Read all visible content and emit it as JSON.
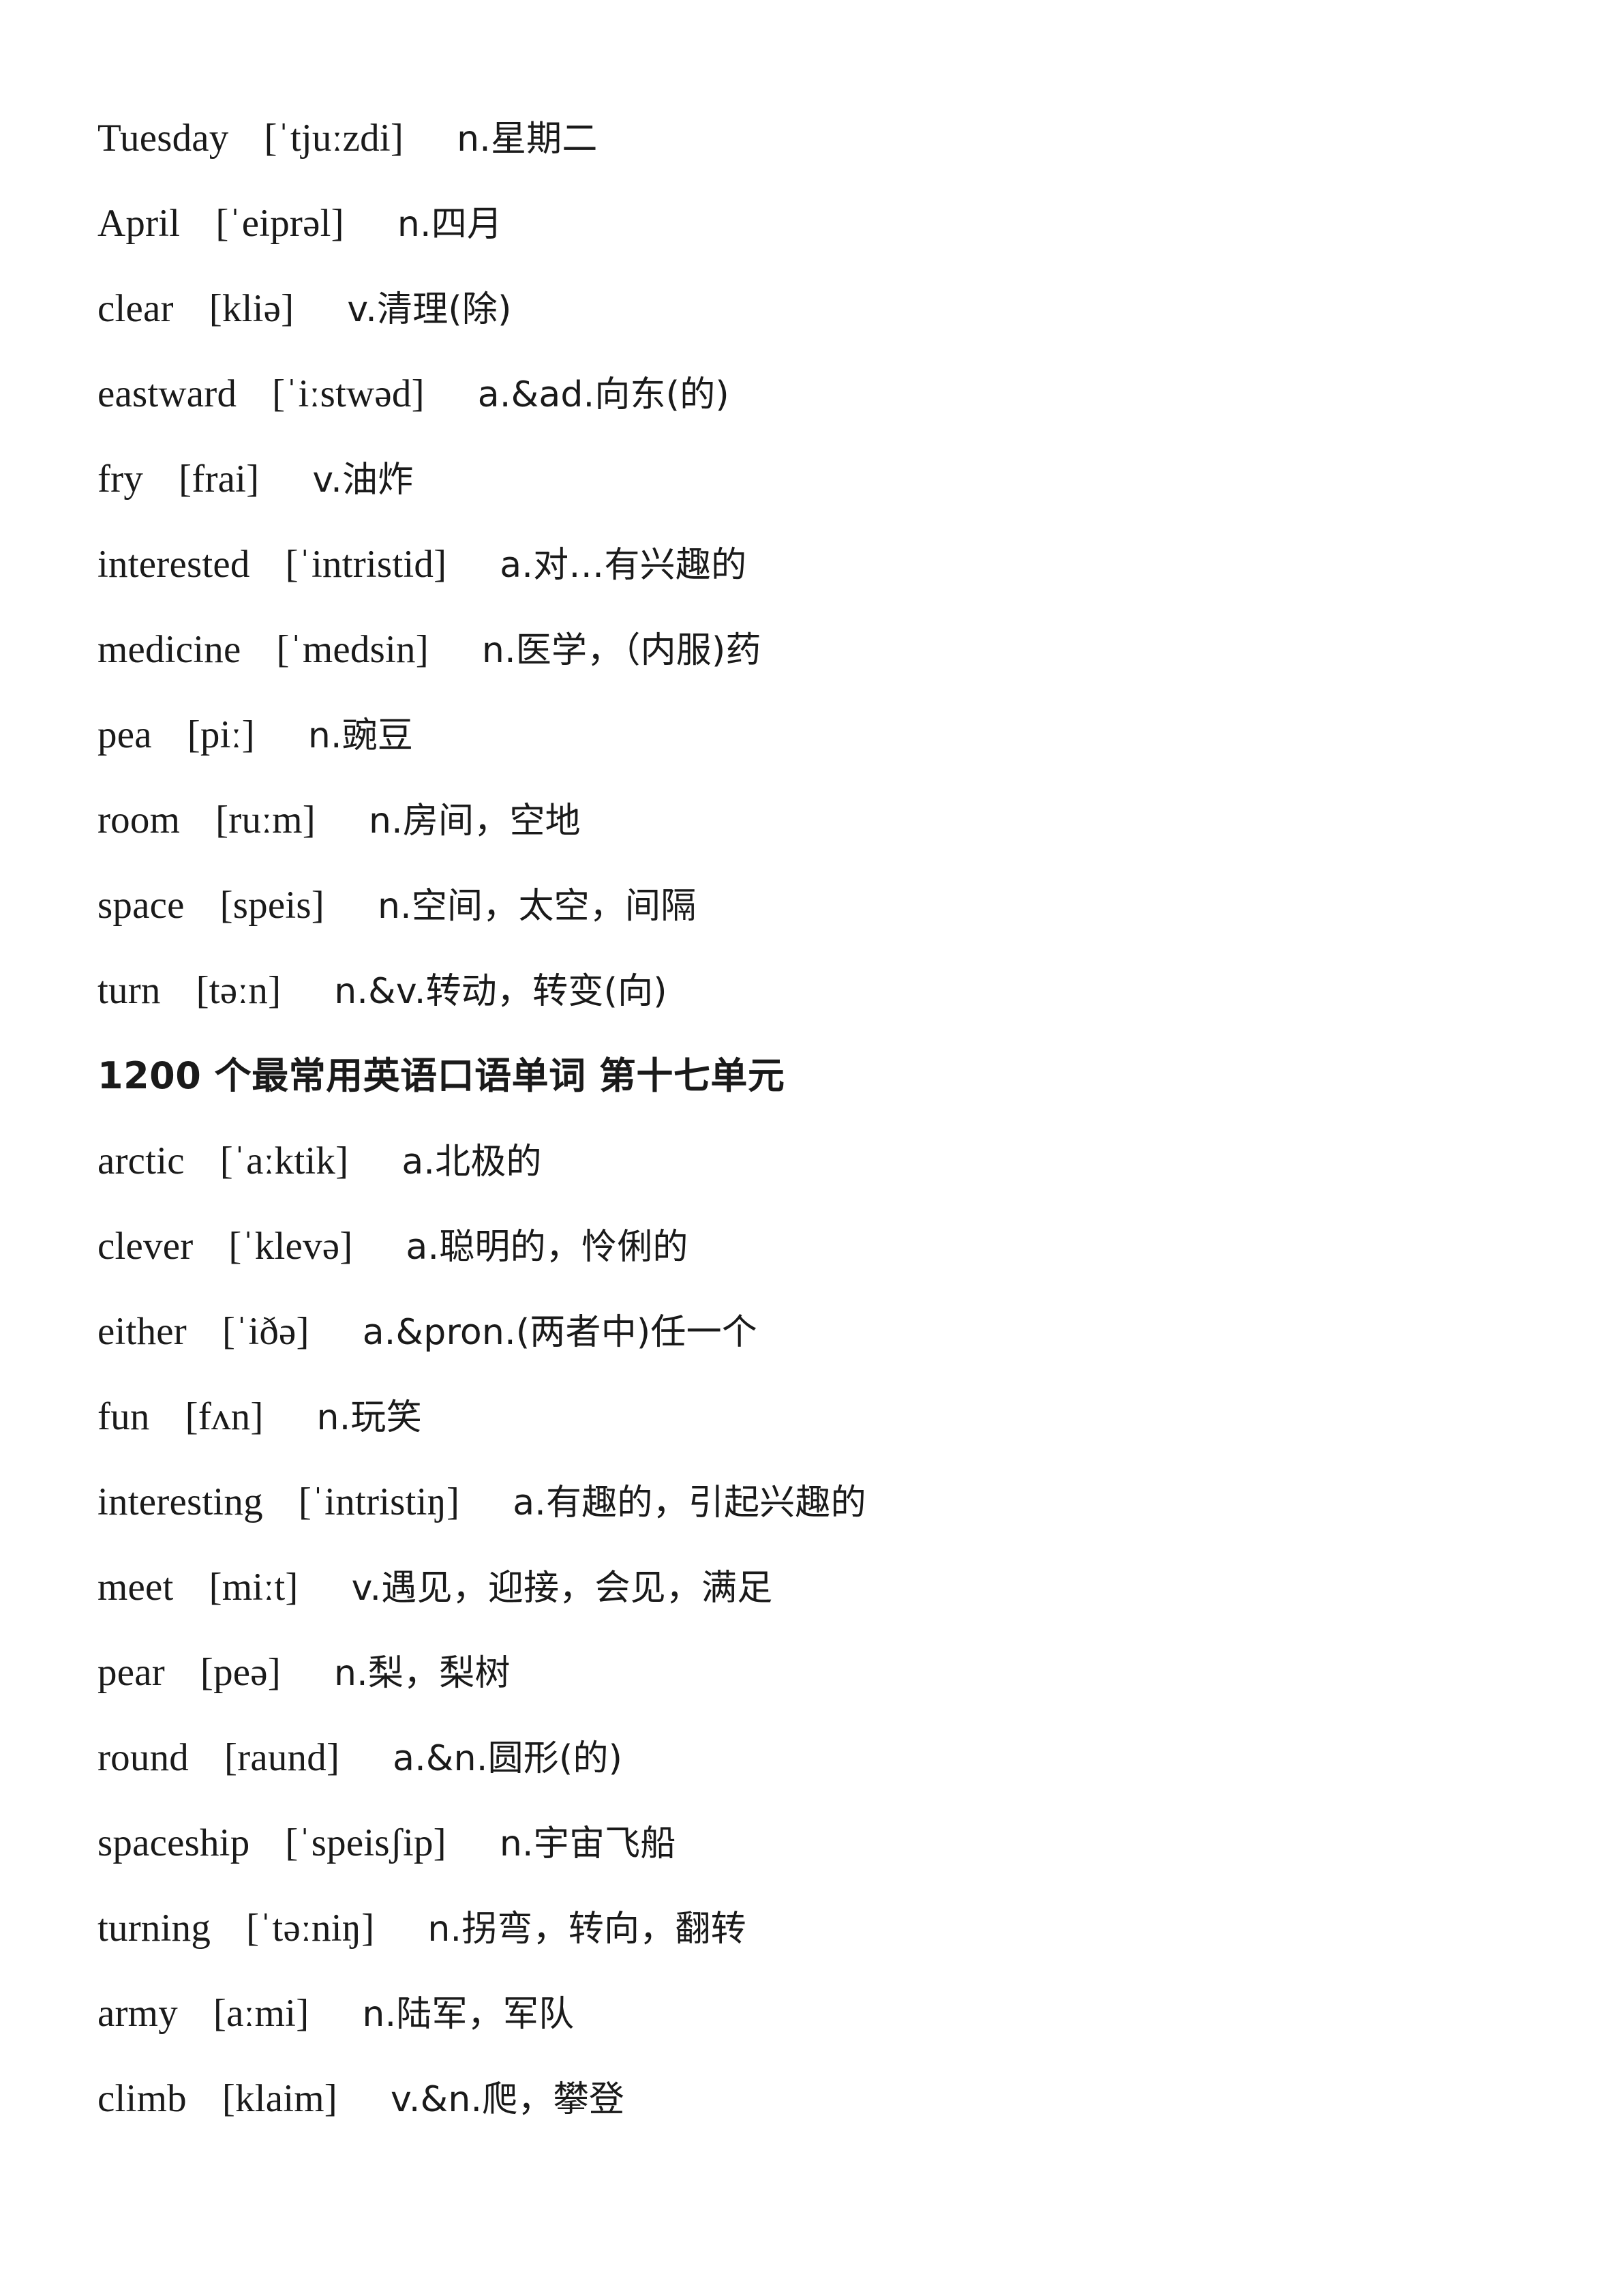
{
  "document": {
    "title": "1200 个最常用英语口语单词 第十七单元"
  },
  "entries": [
    {
      "word": "Tuesday",
      "phonetic": "[ˈtjuːzdi]",
      "definition": "n.星期二",
      "gap1": "gap-md",
      "gap2": "gap-lg"
    },
    {
      "word": "April",
      "phonetic": "[ˈeiprəl]",
      "definition": "n.四月",
      "gap1": "gap-md",
      "gap2": "gap-lg"
    },
    {
      "word": "clear",
      "phonetic": "[kliə]",
      "definition": "v.清理(除)",
      "gap1": "gap-md",
      "gap2": "gap-lg"
    },
    {
      "word": "eastward",
      "phonetic": "[ˈiːstwəd]",
      "definition": "a.&ad.向东(的)",
      "gap1": "gap-md",
      "gap2": "gap-lg"
    },
    {
      "word": "fry",
      "phonetic": "[frai]",
      "definition": "v.油炸",
      "gap1": "gap-md",
      "gap2": "gap-lg"
    },
    {
      "word": "interested",
      "phonetic": "[ˈintristid]",
      "definition": "a.对…有兴趣的",
      "gap1": "gap-md",
      "gap2": "gap-lg"
    },
    {
      "word": "medicine",
      "phonetic": "[ˈmedsin]",
      "definition": "n.医学，（内服)药",
      "gap1": "gap-md",
      "gap2": "gap-lg"
    },
    {
      "word": "pea",
      "phonetic": "[piː]",
      "definition": "n.豌豆",
      "gap1": "gap-md",
      "gap2": "gap-lg"
    },
    {
      "word": "room",
      "phonetic": "[ruːm]",
      "definition": "n.房间，空地",
      "gap1": "gap-md",
      "gap2": "gap-lg"
    },
    {
      "word": "space",
      "phonetic": "[speis]",
      "definition": "n.空间，太空，间隔",
      "gap1": "gap-md",
      "gap2": "gap-lg"
    },
    {
      "word": "turn",
      "phonetic": "[təːn]",
      "definition": "n.&v.转动，转变(向)",
      "gap1": "gap-md",
      "gap2": "gap-lg"
    }
  ],
  "entries2": [
    {
      "word": "arctic",
      "phonetic": "[ˈaːktik]",
      "definition": "a.北极的",
      "gap1": "gap-md",
      "gap2": "gap-lg"
    },
    {
      "word": "clever",
      "phonetic": "[ˈklevə]",
      "definition": "a.聪明的，怜俐的",
      "gap1": "gap-md",
      "gap2": "gap-lg"
    },
    {
      "word": "either",
      "phonetic": "[ˈiðə]",
      "definition": "a.&pron.(两者中)任一个",
      "gap1": "gap-md",
      "gap2": "gap-lg"
    },
    {
      "word": "fun",
      "phonetic": "[fʌn]",
      "definition": "n.玩笑",
      "gap1": "gap-md",
      "gap2": "gap-lg"
    },
    {
      "word": "interesting",
      "phonetic": "[ˈintristiŋ]",
      "definition": "a.有趣的，引起兴趣的",
      "gap1": "gap-md",
      "gap2": "gap-lg"
    },
    {
      "word": "meet",
      "phonetic": "[miːt]",
      "definition": "v.遇见，迎接，会见，满足",
      "gap1": "gap-md",
      "gap2": "gap-lg"
    },
    {
      "word": "pear",
      "phonetic": "[peə]",
      "definition": "n.梨，梨树",
      "gap1": "gap-md",
      "gap2": "gap-lg"
    },
    {
      "word": "round",
      "phonetic": "[raund]",
      "definition": "a.&n.圆形(的)",
      "gap1": "gap-md",
      "gap2": "gap-lg"
    },
    {
      "word": "spaceship",
      "phonetic": "[ˈspeisʃip]",
      "definition": "n.宇宙飞船",
      "gap1": "gap-md",
      "gap2": "gap-lg"
    },
    {
      "word": "turning",
      "phonetic": "[ˈtəːniŋ]",
      "definition": "n.拐弯，转向，翻转",
      "gap1": "gap-md",
      "gap2": "gap-lg"
    },
    {
      "word": "army",
      "phonetic": "[aːmi]",
      "definition": "n.陆军，军队",
      "gap1": "gap-md",
      "gap2": "gap-lg"
    },
    {
      "word": "climb",
      "phonetic": "[klaim]",
      "definition": "v.&n.爬，攀登",
      "gap1": "gap-md",
      "gap2": "gap-lg"
    }
  ]
}
